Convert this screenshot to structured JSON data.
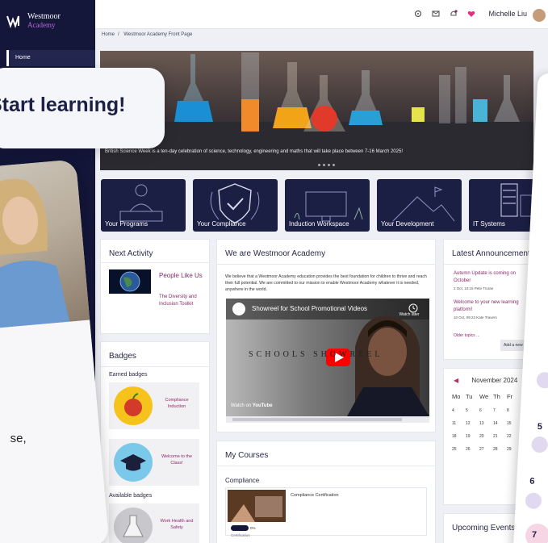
{
  "brand": {
    "name": "Westmoor",
    "sub": "Academy"
  },
  "sidebar": {
    "home_label": "Home"
  },
  "topbar": {
    "user_name": "Michelle Liu"
  },
  "breadcrumb": [
    "Home",
    "Westmoor Academy Front Page"
  ],
  "hero": {
    "caption": "British Science Week is a ten-day celebration of science, technology, engineering and maths that will take place between 7-16 March 2025!"
  },
  "tiles": [
    "Your Programs",
    "Your Compliance",
    "Induction Workspace",
    "Your Development",
    "IT Systems"
  ],
  "next_activity": {
    "title": "Next Activity",
    "item_title": "People Like Us",
    "item_sub": "The Diversity and Inclusion Toolkit"
  },
  "badges": {
    "title": "Badges",
    "earned_label": "Earned badges",
    "earned": [
      {
        "label": "Compliance Induction"
      },
      {
        "label": "Welcome to the Class!"
      }
    ],
    "available_label": "Available badges",
    "available": [
      {
        "label": "Work Health and Safety"
      }
    ]
  },
  "about": {
    "title": "We are Westmoor Academy",
    "body": "We believe that a Westmoor Academy education provides the best foundation for children to thrive and reach their full potential. We are committed to our mission to enable Westmoor Academy whatever it is needed, anywhere in the world.",
    "video_title": "Showreel for School Promotional Videos",
    "video_watch_later": "Watch later",
    "video_overlay": "SCHOOLS SHOWREEL",
    "watch_on": "Watch on",
    "youtube": "YouTube"
  },
  "courses": {
    "title": "My Courses",
    "category": "Compliance",
    "items": [
      {
        "name": "Compliance Certification",
        "progress_pct": 0,
        "progress_label": "0%",
        "cert": "Certification"
      }
    ]
  },
  "announcements": {
    "title": "Latest Announcements",
    "items": [
      {
        "title": "Autumn Update is coming on October",
        "meta": "2 Oct, 10:15 Pete Truran"
      },
      {
        "title": "Welcome to your new learning platform!",
        "meta": "10 Oct, 09:23 Kate Travers"
      }
    ],
    "older_label": "Older topics ...",
    "add_label": "Add a new topic"
  },
  "calendar": {
    "month": "November 2024",
    "day_headers": [
      "Mo",
      "Tu",
      "We",
      "Th",
      "Fr"
    ],
    "rows": [
      [
        "4",
        "5",
        "6",
        "7",
        "8"
      ],
      [
        "11",
        "12",
        "13",
        "14",
        "15"
      ],
      [
        "18",
        "19",
        "20",
        "21",
        "22"
      ],
      [
        "25",
        "26",
        "27",
        "28",
        "29"
      ]
    ]
  },
  "upcoming": {
    "title": "Upcoming Events"
  },
  "overlay": {
    "cta": "Start learning!",
    "phone_fragment": "se,",
    "numbers": [
      "5",
      "6",
      "7"
    ]
  },
  "colors": {
    "sidebar": "#14163a",
    "accent": "#8a2a6a",
    "youtube": "#ff0000"
  }
}
